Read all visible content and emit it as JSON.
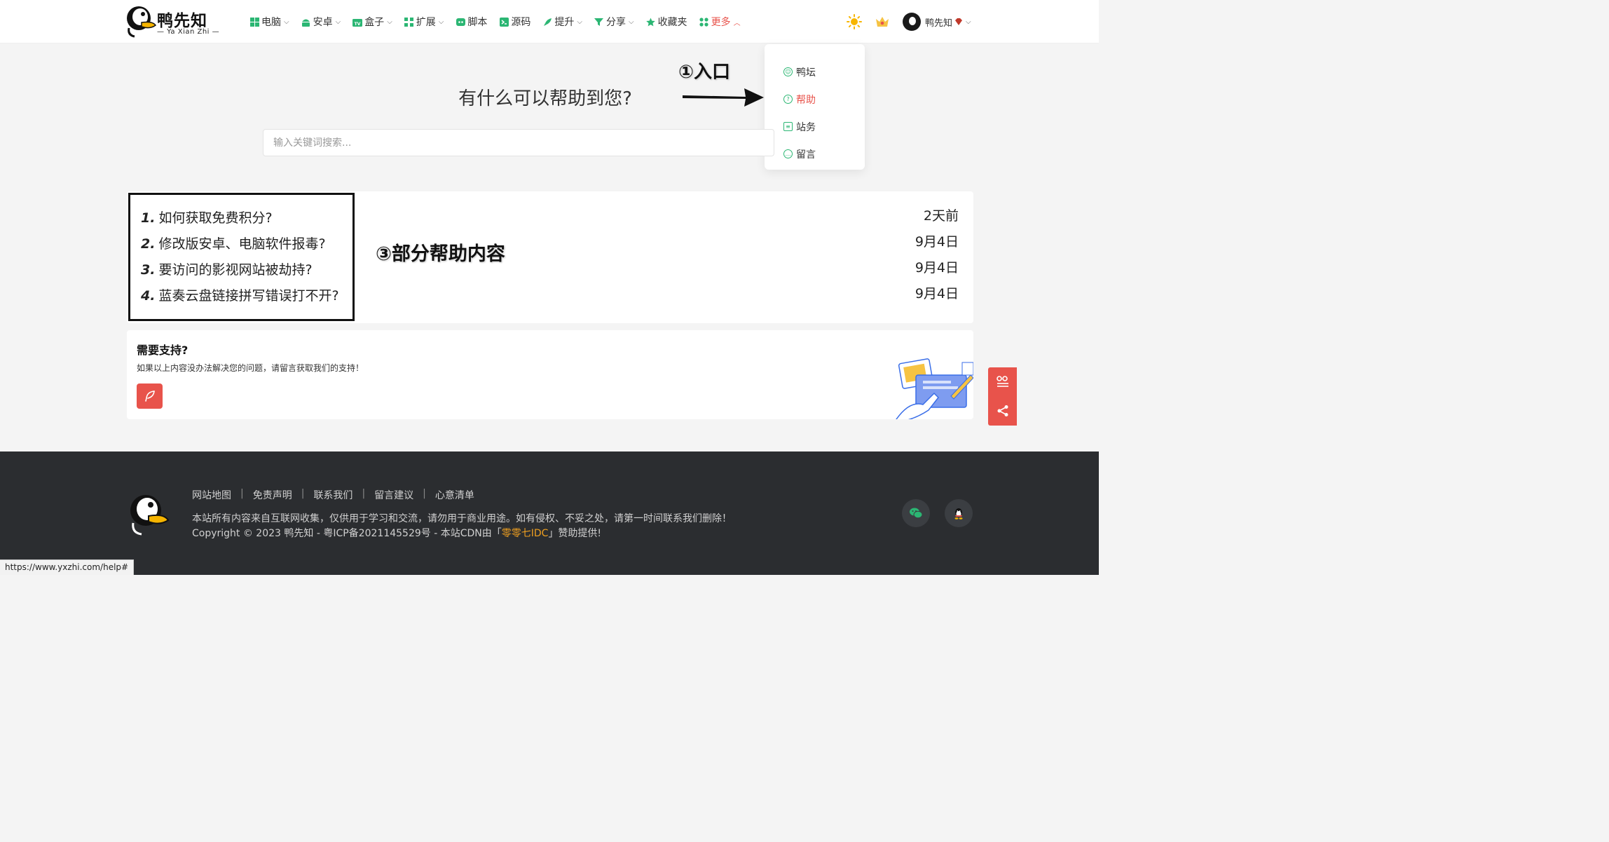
{
  "header": {
    "logo_text": "鸭先知",
    "logo_sub": "— Ya Xian Zhi —",
    "nav": [
      {
        "label": "电脑",
        "has_caret": true
      },
      {
        "label": "安卓",
        "has_caret": true
      },
      {
        "label": "盒子",
        "has_caret": true
      },
      {
        "label": "扩展",
        "has_caret": true
      },
      {
        "label": "脚本",
        "has_caret": false
      },
      {
        "label": "源码",
        "has_caret": false
      },
      {
        "label": "提升",
        "has_caret": true
      },
      {
        "label": "分享",
        "has_caret": true
      },
      {
        "label": "收藏夹",
        "has_caret": false
      },
      {
        "label": "更多",
        "has_caret": true
      }
    ],
    "user_name": "鸭先知",
    "caret_down": "⌵",
    "caret_up": "︿"
  },
  "dropdown": {
    "items": [
      {
        "label": "鸭坛"
      },
      {
        "label": "帮助"
      },
      {
        "label": "站务"
      },
      {
        "label": "留言"
      }
    ]
  },
  "hero": {
    "title": "有什么可以帮助到您?",
    "search_placeholder": "输入关键词搜索..."
  },
  "annotations": {
    "entry": "①入口",
    "content": "③部分帮助内容"
  },
  "help_list": [
    {
      "num": "1.",
      "title": "如何获取免费积分?",
      "date": "2天前"
    },
    {
      "num": "2.",
      "title": "修改版安卓、电脑软件报毒?",
      "date": "9月4日"
    },
    {
      "num": "3.",
      "title": "要访问的影视网站被劫持?",
      "date": "9月4日"
    },
    {
      "num": "4.",
      "title": "蓝奏云盘链接拼写错误打不开?",
      "date": "9月4日"
    }
  ],
  "support": {
    "title": "需要支持?",
    "desc": "如果以上内容没办法解决您的问题，请留言获取我们的支持！"
  },
  "footer": {
    "links": [
      "网站地图",
      "免责声明",
      "联系我们",
      "留言建议",
      "心意清单"
    ],
    "separator": "|",
    "notice": "本站所有内容来自互联网收集，仅供用于学习和交流，请勿用于商业用途。如有侵权、不妥之处，请第一时间联系我们删除！",
    "copyright_prefix": "Copyright © 2023 鸭先知 - 粤ICP备2021145529号 - 本站CDN由「",
    "cdn_name": "零零七IDC",
    "copyright_suffix": "」赞助提供!"
  },
  "status_url": "https://www.yxzhi.com/help#",
  "colors": {
    "accent_red": "#e8534b",
    "icon_green": "#2bb673",
    "footer_bg": "#2b2d30",
    "link_orange": "#f0a020"
  }
}
